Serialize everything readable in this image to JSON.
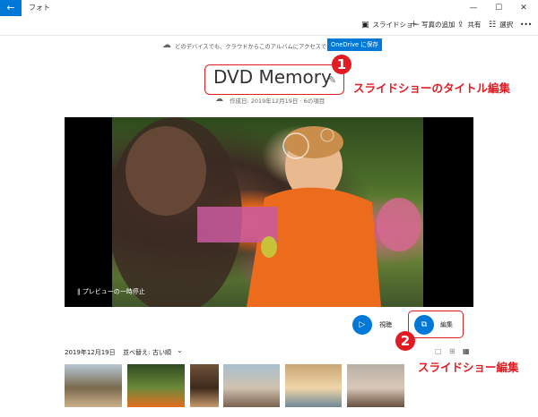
{
  "window": {
    "back_glyph": "←",
    "app_title": "フォト",
    "minimize": "—",
    "maximize": "☐",
    "close": "✕"
  },
  "toolbar": {
    "slideshow_label": "スライドショー",
    "add_photos_label": "写真の追加",
    "share_label": "共有",
    "select_label": "選択",
    "more_label": "•••"
  },
  "banner": {
    "message": "どのデバイスでも、クラウドからこのアルバムにアクセスできます。",
    "button_label": "OneDrive に保存"
  },
  "album": {
    "title": "DVD Memory",
    "created_date": "作成日: 2019年12月19日",
    "separator": "·",
    "item_count": "6の項目"
  },
  "annotations": {
    "badge_1": "1",
    "label_1": "スライドショーのタイトル編集",
    "badge_2": "2",
    "label_2": "スライドショー編集"
  },
  "video": {
    "pause_label": "プレビューの一時停止"
  },
  "controls": {
    "watch_label": "視聴",
    "edit_label": "編集"
  },
  "list": {
    "date_header": "2019年12月19日",
    "sort_label": "並べ替え:",
    "sort_value": "古い順"
  },
  "thumbnails": [
    {
      "name": "girl-field",
      "colors": [
        "#b8c7d6",
        "#c9b08a",
        "#7a6a4e"
      ]
    },
    {
      "name": "boy-bubbles",
      "colors": [
        "#2f4a22",
        "#e46d1e",
        "#6c8a3a"
      ]
    },
    {
      "name": "girl-portrait",
      "colors": [
        "#6e5238",
        "#c79a6e",
        "#3e2a1c"
      ]
    },
    {
      "name": "family-sea",
      "colors": [
        "#a8bfcf",
        "#7b6250",
        "#d0c2b0"
      ]
    },
    {
      "name": "beach-sunset",
      "colors": [
        "#c9a574",
        "#6f8798",
        "#f0d6a8"
      ]
    },
    {
      "name": "crowd-group",
      "colors": [
        "#b7b0a6",
        "#6a4f3f",
        "#d9c8b8"
      ]
    }
  ],
  "colors": {
    "accent": "#0078d7",
    "annotation_red": "#e21b23"
  }
}
